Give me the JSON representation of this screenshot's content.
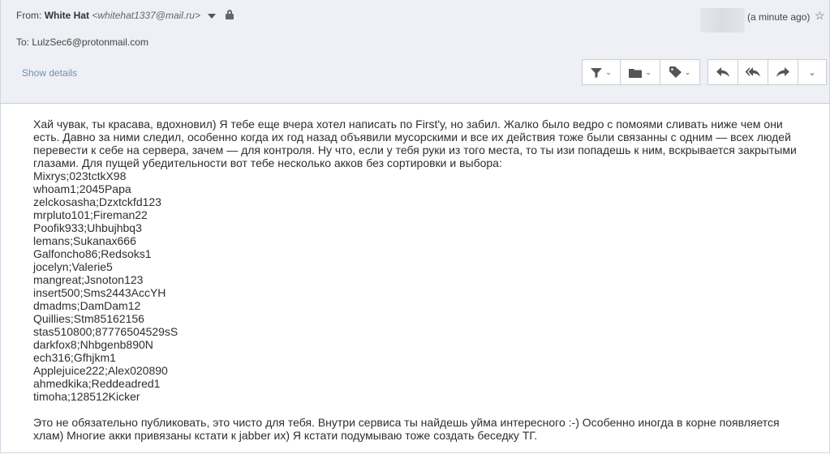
{
  "header": {
    "from_label": "From:",
    "sender_name": "White Hat",
    "sender_email": "<whitehat1337@mail.ru>",
    "to_label": "To:",
    "to_email": "LulzSec6@protonmail.com",
    "time": "(a minute ago)",
    "show_details": "Show details"
  },
  "toolbar": {
    "icons": [
      "filter-icon",
      "folder-icon",
      "tag-icon",
      "reply-icon",
      "reply-all-icon",
      "forward-icon",
      "more-chevron-icon"
    ]
  },
  "message": {
    "intro": "Хай чувак, ты красава, вдохновил) Я тебе еще вчера хотел написать по First'у, но забил. Жалко было ведро с помоями сливать ниже чем они есть. Давно за ними следил, особенно когда их год назад объявили мусорскими и все их действия тоже были связанны с одним — всех людей перевести к себе на сервера, зачем — для контроля. Ну что, если у тебя руки из того места, то ты изи попадешь к ним, вскрывается закрытыми глазами. Для пущей убедительности вот тебе несколько акков без сортировки и выбора:",
    "accounts": [
      "Mixrys;023tctkX98",
      "whoam1;2045Papa",
      "zelckosasha;Dzxtckfd123",
      "mrpluto101;Fireman22",
      "Poofik933;Uhbujhbq3",
      "lemans;Sukanax666",
      "Galfoncho86;Redsoks1",
      "jocelyn;Valerie5",
      "mangreat;Jsnoton123",
      "insert500;Sms2443AccYH",
      "dmadms;DamDam12",
      "Quillies;Stm85162156",
      "stas510800;87776504529sS",
      "darkfox8;Nhbgenb890N",
      "ech316;Gfhjkm1",
      "Applejuice222;Alex020890",
      "ahmedkika;Reddeadred1",
      "timoha;128512Kicker"
    ],
    "closing": "Это не обязательно публиковать, это чисто для тебя. Внутри сервиса ты найдешь уйма интересного :-) Особенно иногда в корне появляется хлам) Многие акки привязаны кстати к jabber их) Я кстати подумываю тоже создать беседку ТГ."
  }
}
